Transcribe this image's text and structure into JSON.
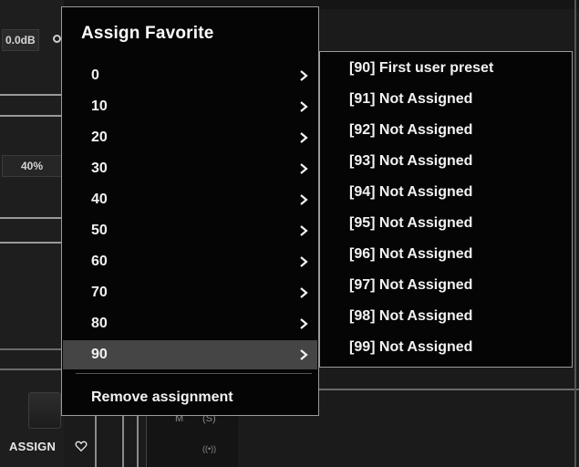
{
  "background": {
    "gain_readout": "0.0dB",
    "percent_readout": "40%",
    "assign_label": "ASSIGN",
    "mini_label_m": "M",
    "mini_label_s": "(S)",
    "mini_label_wireless": "((•))"
  },
  "menu": {
    "title": "Assign Favorite",
    "items": [
      {
        "label": "0"
      },
      {
        "label": "10"
      },
      {
        "label": "20"
      },
      {
        "label": "30"
      },
      {
        "label": "40"
      },
      {
        "label": "50"
      },
      {
        "label": "60"
      },
      {
        "label": "70"
      },
      {
        "label": "80"
      },
      {
        "label": "90",
        "selected": true
      }
    ],
    "remove_label": "Remove assignment"
  },
  "submenu": {
    "items": [
      {
        "label": "[90] First user preset"
      },
      {
        "label": "[91] Not Assigned"
      },
      {
        "label": "[92] Not Assigned"
      },
      {
        "label": "[93] Not Assigned"
      },
      {
        "label": "[94] Not Assigned"
      },
      {
        "label": "[95] Not Assigned"
      },
      {
        "label": "[96] Not Assigned"
      },
      {
        "label": "[97] Not Assigned"
      },
      {
        "label": "[98] Not Assigned"
      },
      {
        "label": "[99] Not Assigned"
      }
    ]
  },
  "colors": {
    "menu_bg": "#050505",
    "menu_border": "#9a9a9a",
    "selected_bg": "#454545",
    "text": "#f2f2f2"
  }
}
